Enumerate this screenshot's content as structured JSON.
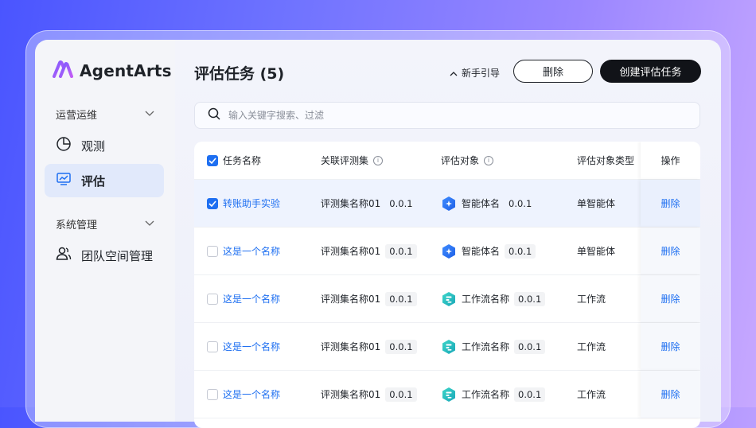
{
  "app": {
    "name": "AgentArts"
  },
  "sidebar": {
    "section1": "运营运维",
    "item_observe": "观测",
    "item_eval": "评估",
    "section2": "系统管理",
    "item_team": "团队空间管理"
  },
  "header": {
    "title": "评估任务 (5)",
    "guide": "新手引导",
    "delete_label": "删除",
    "create_label": "创建评估任务"
  },
  "search": {
    "placeholder": "输入关键字搜索、过滤"
  },
  "table": {
    "columns": {
      "name": "任务名称",
      "dataset": "关联评测集",
      "target": "评估对象",
      "target_type": "评估对象类型",
      "op": "操作"
    },
    "rows": [
      {
        "checked": true,
        "name": "转账助手实验",
        "dataset": "评测集名称01",
        "dataset_ver": "0.0.1",
        "target": "智能体名",
        "target_ver": "0.0.1",
        "icon": "agent",
        "type": "单智能体",
        "op": "删除"
      },
      {
        "checked": false,
        "name": "这是一个名称",
        "dataset": "评测集名称01",
        "dataset_ver": "0.0.1",
        "target": "智能体名",
        "target_ver": "0.0.1",
        "icon": "agent",
        "type": "单智能体",
        "op": "删除"
      },
      {
        "checked": false,
        "name": "这是一个名称",
        "dataset": "评测集名称01",
        "dataset_ver": "0.0.1",
        "target": "工作流名称",
        "target_ver": "0.0.1",
        "icon": "workflow",
        "type": "工作流",
        "op": "删除"
      },
      {
        "checked": false,
        "name": "这是一个名称",
        "dataset": "评测集名称01",
        "dataset_ver": "0.0.1",
        "target": "工作流名称",
        "target_ver": "0.0.1",
        "icon": "workflow",
        "type": "工作流",
        "op": "删除"
      },
      {
        "checked": false,
        "name": "这是一个名称",
        "dataset": "评测集名称01",
        "dataset_ver": "0.0.1",
        "target": "工作流名称",
        "target_ver": "0.0.1",
        "icon": "workflow",
        "type": "工作流",
        "op": "删除"
      }
    ]
  },
  "colors": {
    "accent": "#1e6ff1",
    "dark": "#111318"
  }
}
